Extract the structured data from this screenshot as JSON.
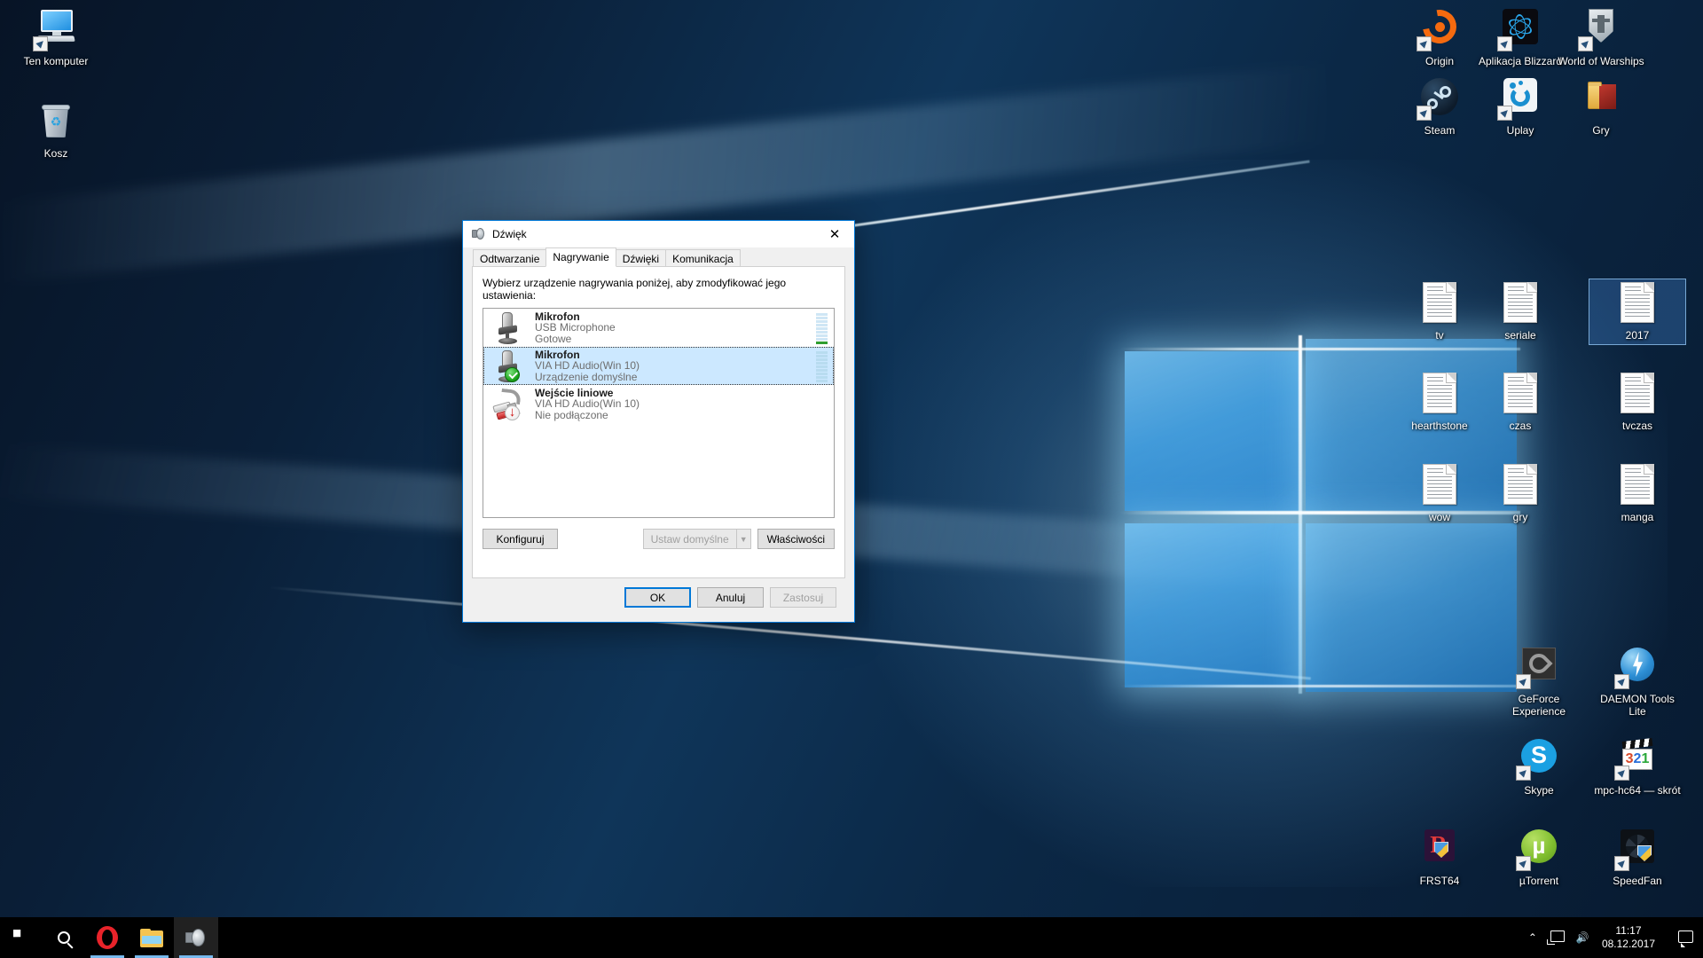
{
  "desktop": {
    "icons_left": [
      {
        "label": "Ten komputer",
        "icon": "this-pc-icon",
        "shortcut": true,
        "selected": false
      },
      {
        "label": "Kosz",
        "icon": "recycle-bin-icon",
        "shortcut": false,
        "selected": false
      }
    ],
    "icons_right": [
      {
        "label": "Origin",
        "icon": "origin-icon",
        "shortcut": true,
        "selected": false
      },
      {
        "label": "Aplikacja Blizzard",
        "icon": "blizzard-app-icon",
        "shortcut": true,
        "selected": false
      },
      {
        "label": "World of Warships",
        "icon": "world-of-warships-icon",
        "shortcut": true,
        "selected": false
      },
      {
        "label": "Steam",
        "icon": "steam-icon",
        "shortcut": true,
        "selected": false
      },
      {
        "label": "Uplay",
        "icon": "uplay-icon",
        "shortcut": true,
        "selected": false
      },
      {
        "label": "Gry",
        "icon": "folder-icon",
        "shortcut": false,
        "selected": false
      },
      {
        "label": "tv",
        "icon": "text-file-icon",
        "shortcut": false,
        "selected": false
      },
      {
        "label": "seriale",
        "icon": "text-file-icon",
        "shortcut": false,
        "selected": false
      },
      {
        "label": "2017",
        "icon": "text-file-icon",
        "shortcut": false,
        "selected": true
      },
      {
        "label": "hearthstone",
        "icon": "text-file-icon",
        "shortcut": false,
        "selected": false
      },
      {
        "label": "czas",
        "icon": "text-file-icon",
        "shortcut": false,
        "selected": false
      },
      {
        "label": "tvczas",
        "icon": "text-file-icon",
        "shortcut": false,
        "selected": false
      },
      {
        "label": "wow",
        "icon": "text-file-icon",
        "shortcut": false,
        "selected": false
      },
      {
        "label": "gry",
        "icon": "text-file-icon",
        "shortcut": false,
        "selected": false
      },
      {
        "label": "manga",
        "icon": "text-file-icon",
        "shortcut": false,
        "selected": false
      },
      {
        "label": "GeForce Experience",
        "icon": "geforce-experience-icon",
        "shortcut": true,
        "selected": false
      },
      {
        "label": "DAEMON Tools Lite",
        "icon": "daemon-tools-icon",
        "shortcut": true,
        "selected": false
      },
      {
        "label": "Skype",
        "icon": "skype-icon",
        "shortcut": true,
        "selected": false
      },
      {
        "label": "mpc-hc64 — skrót",
        "icon": "mpc-hc-icon",
        "shortcut": true,
        "selected": false
      },
      {
        "label": "FRST64",
        "icon": "frst64-icon",
        "shortcut": false,
        "selected": false
      },
      {
        "label": "µTorrent",
        "icon": "utorrent-icon",
        "shortcut": true,
        "selected": false
      },
      {
        "label": "SpeedFan",
        "icon": "speedfan-icon",
        "shortcut": true,
        "selected": false
      }
    ]
  },
  "taskbar": {
    "start": "start-button",
    "search": "search-icon",
    "apps": [
      {
        "name": "opera-taskbar-button",
        "icon": "opera-icon",
        "active": false,
        "running": true
      },
      {
        "name": "file-explorer-taskbar-button",
        "icon": "folder-icon",
        "active": false,
        "running": true
      },
      {
        "name": "sound-control-panel-taskbar-button",
        "icon": "speaker-icon",
        "active": true,
        "running": true
      }
    ],
    "tray": {
      "show_hidden": "chevron-up-icon",
      "network": "network-icon",
      "volume": "volume-icon",
      "time": "11:17",
      "date": "08.12.2017",
      "action_center": "action-center-icon"
    }
  },
  "dialog": {
    "title": "Dźwięk",
    "close_label": "✕",
    "tabs": [
      {
        "label": "Odtwarzanie",
        "active": false
      },
      {
        "label": "Nagrywanie",
        "active": true
      },
      {
        "label": "Dźwięki",
        "active": false
      },
      {
        "label": "Komunikacja",
        "active": false
      }
    ],
    "hint": "Wybierz urządzenie nagrywania poniżej, aby zmodyfikować jego ustawienia:",
    "devices": [
      {
        "name": "Mikrofon",
        "driver": "USB Microphone",
        "status": "Gotowe",
        "icon": "microphone-icon",
        "badge": "none",
        "selected": false,
        "level_segments": 9,
        "level_active": 1
      },
      {
        "name": "Mikrofon",
        "driver": "VIA HD Audio(Win 10)",
        "status": "Urządzenie domyślne",
        "icon": "microphone-icon",
        "badge": "default-check",
        "selected": true,
        "level_segments": 9,
        "level_active": 0
      },
      {
        "name": "Wejście liniowe",
        "driver": "VIA HD Audio(Win 10)",
        "status": "Nie podłączone",
        "icon": "line-in-icon",
        "badge": "unplugged-arrow",
        "selected": false,
        "level_segments": 0,
        "level_active": 0
      }
    ],
    "buttons": {
      "configure": "Konfiguruj",
      "set_default": "Ustaw domyślne",
      "set_default_disabled": true,
      "properties": "Właściwości",
      "ok": "OK",
      "cancel": "Anuluj",
      "apply": "Zastosuj",
      "apply_disabled": true
    }
  },
  "colors": {
    "accent": "#0078d7",
    "selection": "#cce8ff",
    "taskbar": "#000000",
    "dialog_bg": "#f0f0f0",
    "level_green": "#2f9e2f",
    "level_idle": "#b8dcf0"
  }
}
